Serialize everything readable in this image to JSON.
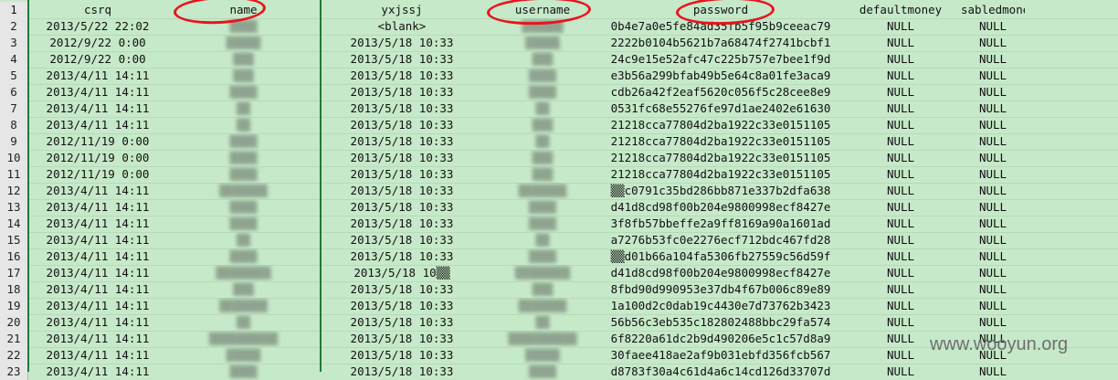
{
  "headers": {
    "row_num": "1",
    "csrq": "csrq",
    "name": "name",
    "yxjssj": "yxjssj",
    "username": "username",
    "password": "password",
    "defaultmoney": "defaultmoney",
    "sabledmoney": "sabledmoney"
  },
  "rows": [
    {
      "n": "2",
      "csrq": "2013/5/22 22:02",
      "name": "▒▒▒▒",
      "yxjssj": "<blank>",
      "username": "▒▒▒▒▒▒",
      "password": "0b4e7a0e5fe84ad35fb5f95b9ceeac79",
      "dm": "NULL",
      "sm": "NULL"
    },
    {
      "n": "3",
      "csrq": "2012/9/22 0:00",
      "name": "▒▒▒▒▒",
      "yxjssj": "2013/5/18 10:33",
      "username": "▒▒▒▒▒",
      "password": "2222b0104b5621b7a68474f2741bcbf1",
      "dm": "NULL",
      "sm": "NULL"
    },
    {
      "n": "4",
      "csrq": "2012/9/22 0:00",
      "name": "▒▒▒",
      "yxjssj": "2013/5/18 10:33",
      "username": "▒▒▒",
      "password": "24c9e15e52afc47c225b757e7bee1f9d",
      "dm": "NULL",
      "sm": "NULL"
    },
    {
      "n": "5",
      "csrq": "2013/4/11 14:11",
      "name": "▒▒▒",
      "yxjssj": "2013/5/18 10:33",
      "username": "▒▒▒▒",
      "password": "e3b56a299bfab49b5e64c8a01fe3aca9",
      "dm": "NULL",
      "sm": "NULL"
    },
    {
      "n": "6",
      "csrq": "2013/4/11 14:11",
      "name": "▒▒▒▒",
      "yxjssj": "2013/5/18 10:33",
      "username": "▒▒▒▒",
      "password": "cdb26a42f2eaf5620c056f5c28cee8e9",
      "dm": "NULL",
      "sm": "NULL"
    },
    {
      "n": "7",
      "csrq": "2013/4/11 14:11",
      "name": "▒▒",
      "yxjssj": "2013/5/18 10:33",
      "username": "▒▒",
      "password": "0531fc68e55276fe97d1ae2402e61630",
      "dm": "NULL",
      "sm": "NULL"
    },
    {
      "n": "8",
      "csrq": "2013/4/11 14:11",
      "name": "▒▒",
      "yxjssj": "2013/5/18 10:33",
      "username": "▒▒▒",
      "password": "21218cca77804d2ba1922c33e0151105",
      "dm": "NULL",
      "sm": "NULL"
    },
    {
      "n": "9",
      "csrq": "2012/11/19 0:00",
      "name": "▒▒▒▒",
      "yxjssj": "2013/5/18 10:33",
      "username": "▒▒",
      "password": "21218cca77804d2ba1922c33e0151105",
      "dm": "NULL",
      "sm": "NULL"
    },
    {
      "n": "10",
      "csrq": "2012/11/19 0:00",
      "name": "▒▒▒▒",
      "yxjssj": "2013/5/18 10:33",
      "username": "▒▒▒",
      "password": "21218cca77804d2ba1922c33e0151105",
      "dm": "NULL",
      "sm": "NULL"
    },
    {
      "n": "11",
      "csrq": "2012/11/19 0:00",
      "name": "▒▒▒▒",
      "yxjssj": "2013/5/18 10:33",
      "username": "▒▒▒",
      "password": "21218cca77804d2ba1922c33e0151105",
      "dm": "NULL",
      "sm": "NULL"
    },
    {
      "n": "12",
      "csrq": "2013/4/11 14:11",
      "name": "▒▒▒▒▒▒▒",
      "yxjssj": "2013/5/18 10:33",
      "username": "▒▒▒▒▒▒▒",
      "password": "▒▒c0791c35bd286bb871e337b2dfa638",
      "dm": "NULL",
      "sm": "NULL"
    },
    {
      "n": "13",
      "csrq": "2013/4/11 14:11",
      "name": "▒▒▒▒",
      "yxjssj": "2013/5/18 10:33",
      "username": "▒▒▒▒",
      "password": "d41d8cd98f00b204e9800998ecf8427e",
      "dm": "NULL",
      "sm": "NULL"
    },
    {
      "n": "14",
      "csrq": "2013/4/11 14:11",
      "name": "▒▒▒▒",
      "yxjssj": "2013/5/18 10:33",
      "username": "▒▒▒▒",
      "password": "3f8fb57bbeffe2a9ff8169a90a1601ad",
      "dm": "NULL",
      "sm": "NULL"
    },
    {
      "n": "15",
      "csrq": "2013/4/11 14:11",
      "name": "▒▒",
      "yxjssj": "2013/5/18 10:33",
      "username": "▒▒",
      "password": "a7276b53fc0e2276ecf712bdc467fd28",
      "dm": "NULL",
      "sm": "NULL"
    },
    {
      "n": "16",
      "csrq": "2013/4/11 14:11",
      "name": "▒▒▒▒",
      "yxjssj": "2013/5/18 10:33",
      "username": "▒▒▒▒",
      "password": "▒▒d01b66a104fa5306fb27559c56d59f",
      "dm": "NULL",
      "sm": "NULL"
    },
    {
      "n": "17",
      "csrq": "2013/4/11 14:11",
      "name": "▒▒▒▒▒▒▒▒",
      "yxjssj": "2013/5/18 10▒▒",
      "username": "▒▒▒▒▒▒▒▒",
      "password": "d41d8cd98f00b204e9800998ecf8427e",
      "dm": "NULL",
      "sm": "NULL"
    },
    {
      "n": "18",
      "csrq": "2013/4/11 14:11",
      "name": "▒▒▒",
      "yxjssj": "2013/5/18 10:33",
      "username": "▒▒▒",
      "password": "8fbd90d990953e37db4f67b006c89e89",
      "dm": "NULL",
      "sm": "NULL"
    },
    {
      "n": "19",
      "csrq": "2013/4/11 14:11",
      "name": "▒▒▒▒▒▒▒",
      "yxjssj": "2013/5/18 10:33",
      "username": "▒▒▒▒▒▒▒",
      "password": "1a100d2c0dab19c4430e7d73762b3423",
      "dm": "NULL",
      "sm": "NULL"
    },
    {
      "n": "20",
      "csrq": "2013/4/11 14:11",
      "name": "▒▒",
      "yxjssj": "2013/5/18 10:33",
      "username": "▒▒",
      "password": "56b56c3eb535c182802488bbc29fa574",
      "dm": "NULL",
      "sm": "NULL"
    },
    {
      "n": "21",
      "csrq": "2013/4/11 14:11",
      "name": "▒▒▒▒▒▒▒▒▒▒",
      "yxjssj": "2013/5/18 10:33",
      "username": "▒▒▒▒▒▒▒▒▒▒",
      "password": "6f8220a61dc2b9d490206e5c1c57d8a9",
      "dm": "NULL",
      "sm": "NULL"
    },
    {
      "n": "22",
      "csrq": "2013/4/11 14:11",
      "name": "▒▒▒▒▒",
      "yxjssj": "2013/5/18 10:33",
      "username": "▒▒▒▒▒",
      "password": "30faee418ae2af9b031ebfd356fcb567",
      "dm": "NULL",
      "sm": "NULL"
    },
    {
      "n": "23",
      "csrq": "2013/4/11 14:11",
      "name": "▒▒▒▒",
      "yxjssj": "2013/5/18 10:33",
      "username": "▒▒▒▒",
      "password": "d8783f30a4c61d4a6c14cd126d33707d",
      "dm": "NULL",
      "sm": "NULL"
    }
  ],
  "watermark": "www.wooyun.org",
  "colors": {
    "sheet_bg": "#c6e9c9",
    "row_header_bg": "#e6e6e6",
    "annotation_red": "#e8141e",
    "column_divider": "#1f7a3c"
  }
}
